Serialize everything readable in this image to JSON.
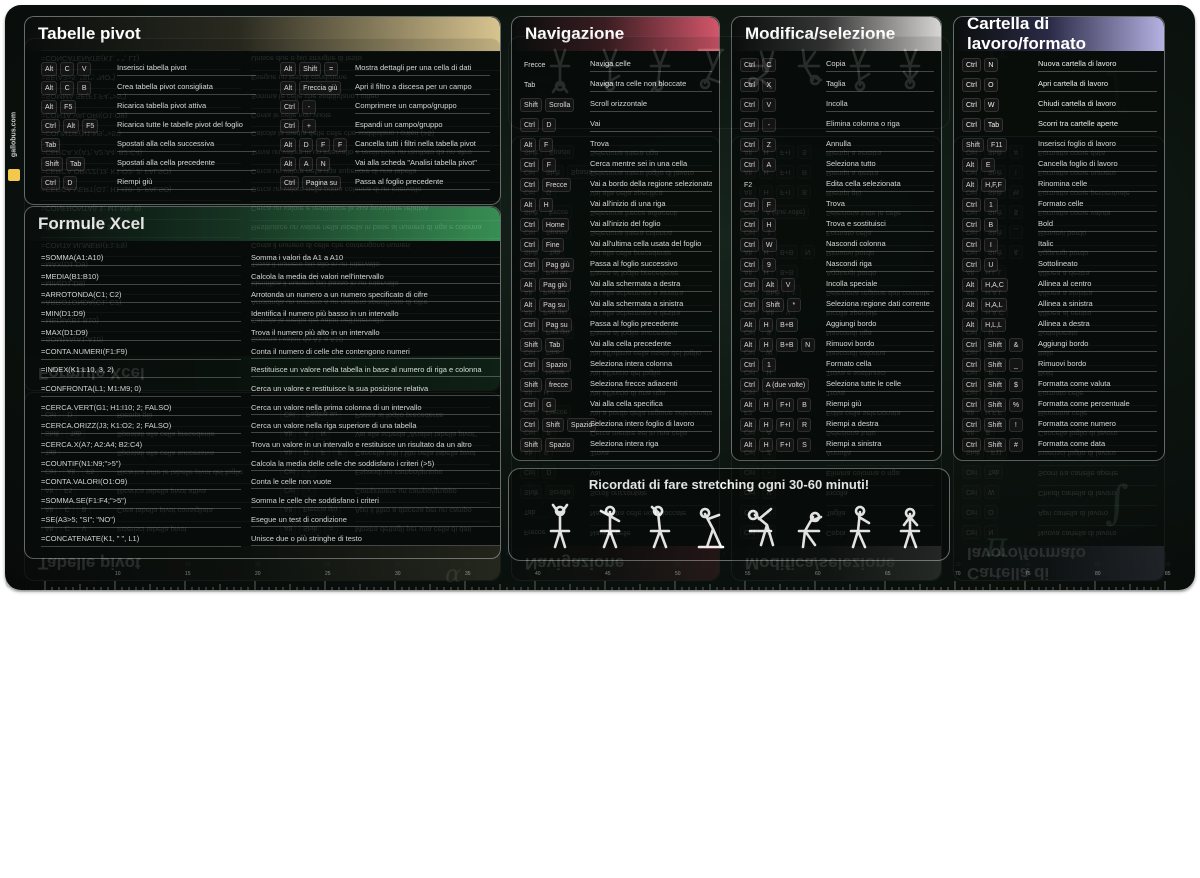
{
  "brand": {
    "name": "gallobus.com"
  },
  "stretch": {
    "title": "Ricordati di fare stretching ogni 30-60 minuti!"
  },
  "ruler": {
    "numbers": [
      "10",
      "15",
      "20",
      "25",
      "30",
      "35",
      "40",
      "45",
      "50",
      "55",
      "60",
      "65",
      "70",
      "75",
      "80",
      "85"
    ]
  },
  "pivot": {
    "title": "Tabelle pivot",
    "left": [
      {
        "keys": [
          "Alt",
          "C",
          "V"
        ],
        "desc": "Inserisci tabella pivot"
      },
      {
        "keys": [
          "Alt",
          "C",
          "B"
        ],
        "desc": "Crea tabella pivot consigliata"
      },
      {
        "keys": [
          "Alt",
          "F5"
        ],
        "desc": "Ricarica tabella pivot attiva"
      },
      {
        "keys": [
          "Ctrl",
          "Alt",
          "F5"
        ],
        "desc": "Ricarica tutte le tabelle pivot del foglio"
      },
      {
        "keys": [
          "Tab"
        ],
        "desc": "Spostati alla cella successiva"
      },
      {
        "keys": [
          "Shift",
          "Tab"
        ],
        "desc": "Spostati alla cella precedente"
      },
      {
        "keys": [
          "Ctrl",
          "D"
        ],
        "desc": "Riempi giù"
      }
    ],
    "right": [
      {
        "keys": [
          "Alt",
          "Shift",
          "="
        ],
        "desc": "Mostra dettagli per una cella di dati"
      },
      {
        "keys": [
          "Alt",
          "Freccia giù"
        ],
        "desc": "Apri il filtro a discesa per un campo"
      },
      {
        "keys": [
          "Ctrl",
          "-"
        ],
        "desc": "Comprimere un campo/gruppo"
      },
      {
        "keys": [
          "Ctrl",
          "+"
        ],
        "desc": "Espandi un campo/gruppo"
      },
      {
        "keys": [
          "Alt",
          "D",
          "F",
          "F"
        ],
        "desc": "Cancella tutti i filtri nella tabella pivot"
      },
      {
        "keys": [
          "Alt",
          "A",
          "N"
        ],
        "desc": "Vai alla scheda \"Analisi tabella pivot\""
      },
      {
        "keys": [
          "Ctrl",
          "Pagina su"
        ],
        "desc": "Passa al foglio precedente"
      }
    ]
  },
  "formulas": {
    "title": "Formule Xcel",
    "rows": [
      {
        "f": "=SOMMA(A1:A10)",
        "d": "Somma i valori da A1 a A10"
      },
      {
        "f": "=MEDIA(B1:B10)",
        "d": "Calcola la media dei valori nell'intervallo"
      },
      {
        "f": "=ARROTONDA(C1; C2)",
        "d": "Arrotonda un numero a un numero specificato di cifre"
      },
      {
        "f": "=MIN(D1:D9)",
        "d": "Identifica il numero più basso in un intervallo"
      },
      {
        "f": "=MAX(D1:D9)",
        "d": "Trova il numero più alto in un intervallo"
      },
      {
        "f": "=CONTA.NUMERI(F1:F9)",
        "d": "Conta il numero di celle che contengono numeri"
      },
      {
        "f": "=INDEX(K1:L10, 3, 2)",
        "d": "Restituisce un valore nella tabella in base al numero di riga e colonna"
      },
      {
        "f": "=CONFRONTA(L1; M1:M9; 0)",
        "d": "Cerca un valore e restituisce la sua posizione relativa"
      },
      {
        "f": "=CERCA.VERT(G1; H1:I10; 2; FALSO)",
        "d": "Cerca un valore nella prima colonna di un intervallo"
      },
      {
        "f": "=CERCA.ORIZZ(J3; K1:O2; 2; FALSO)",
        "d": "Cerca un valore nella riga superiore di una tabella"
      },
      {
        "f": "=CERCA.X(A7; A2:A4; B2:C4)",
        "d": "Trova un valore in un intervallo e restituisce un risultato da un altro"
      },
      {
        "f": "=COUNTIF(N1:N9;\">5\")",
        "d": "Calcola la media delle celle che soddisfano i criteri (>5)"
      },
      {
        "f": "=CONTA.VALORI(O1:O9)",
        "d": "Conta le celle non vuote"
      },
      {
        "f": "=SOMMA.SE(F1:F4;\">5\")",
        "d": "Somma le celle che soddisfano i criteri"
      },
      {
        "f": "=SE(A3>5; \"SI\"; \"NO\")",
        "d": "Esegue un test di condizione"
      },
      {
        "f": "=CONCATENATE(K1, \" \", L1)",
        "d": "Unisce due o più stringhe di testo"
      }
    ]
  },
  "navigation": {
    "title": "Navigazione",
    "rows": [
      {
        "keys": [
          "Frecce"
        ],
        "desc": "Naviga celle",
        "plain": true
      },
      {
        "keys": [
          "Tab"
        ],
        "desc": "Naviga tra celle non bloccate",
        "plain": true
      },
      {
        "keys": [
          "Shift",
          "Scrolla"
        ],
        "desc": "Scroll orizzontale"
      },
      {
        "keys": [
          "Ctrl",
          "D"
        ],
        "desc": "Vai"
      },
      {
        "keys": [
          "Alt",
          "F"
        ],
        "desc": "Trova"
      },
      {
        "keys": [
          "Ctrl",
          "F"
        ],
        "desc": "Cerca mentre sei in una cella"
      },
      {
        "keys": [
          "Ctrl",
          "Frecce"
        ],
        "desc": "Vai a bordo della regione selezionata"
      },
      {
        "keys": [
          "Alt",
          "H"
        ],
        "desc": "Vai all'inizio di una riga"
      },
      {
        "keys": [
          "Ctrl",
          "Home"
        ],
        "desc": "Vai all'inizio del foglio"
      },
      {
        "keys": [
          "Ctrl",
          "Fine"
        ],
        "desc": "Vai all'ultima cella usata del foglio"
      },
      {
        "keys": [
          "Ctrl",
          "Pag giù"
        ],
        "desc": "Passa al foglio successivo"
      },
      {
        "keys": [
          "Alt",
          "Pag giù"
        ],
        "desc": "Vai alla schermata a destra"
      },
      {
        "keys": [
          "Alt",
          "Pag su"
        ],
        "desc": "Vai alla schermata a sinistra"
      },
      {
        "keys": [
          "Ctrl",
          "Pag su"
        ],
        "desc": "Passa al foglio precedente"
      },
      {
        "keys": [
          "Shift",
          "Tab"
        ],
        "desc": "Vai alla cella precedente"
      },
      {
        "keys": [
          "Ctrl",
          "Spazio"
        ],
        "desc": "Seleziona intera colonna"
      },
      {
        "keys": [
          "Shift",
          "freccе"
        ],
        "desc": "Seleziona frecce adiacenti"
      },
      {
        "keys": [
          "Ctrl",
          "G"
        ],
        "desc": "Vai alla cella specifica"
      },
      {
        "keys": [
          "Ctrl",
          "Shift",
          "Spazio"
        ],
        "desc": "Seleziona intero foglio di lavoro"
      },
      {
        "keys": [
          "Shift",
          "Spazio"
        ],
        "desc": "Seleziona intera riga"
      }
    ]
  },
  "modify": {
    "title": "Modifica/selezione",
    "rows": [
      {
        "keys": [
          "Ctrl",
          "C"
        ],
        "desc": "Copia"
      },
      {
        "keys": [
          "Ctrl",
          "X"
        ],
        "desc": "Taglia"
      },
      {
        "keys": [
          "Ctrl",
          "V"
        ],
        "desc": "Incolla"
      },
      {
        "keys": [
          "Ctrl",
          "-"
        ],
        "desc": "Elimina colonna o riga"
      },
      {
        "keys": [
          "Ctrl",
          "Z"
        ],
        "desc": "Annulla"
      },
      {
        "keys": [
          "Ctrl",
          "A"
        ],
        "desc": "Seleziona tutto"
      },
      {
        "keys": [
          "F2"
        ],
        "desc": "Edita cella selezionata",
        "plain": true
      },
      {
        "keys": [
          "Ctrl",
          "F"
        ],
        "desc": "Trova"
      },
      {
        "keys": [
          "Ctrl",
          "H"
        ],
        "desc": "Trova e sostituisci"
      },
      {
        "keys": [
          "Ctrl",
          "W"
        ],
        "desc": "Nascondi colonna"
      },
      {
        "keys": [
          "Ctrl",
          "9"
        ],
        "desc": "Nascondi riga"
      },
      {
        "keys": [
          "Ctrl",
          "Alt",
          "V"
        ],
        "desc": "Incolla speciale"
      },
      {
        "keys": [
          "Ctrl",
          "Shift",
          "*"
        ],
        "desc": "Seleziona regione dati corrente"
      },
      {
        "keys": [
          "Alt",
          "H",
          "B+B"
        ],
        "desc": "Aggiungi bordo"
      },
      {
        "keys": [
          "Alt",
          "H",
          "B+B",
          "N"
        ],
        "desc": "Rimuovi bordo"
      },
      {
        "keys": [
          "Ctrl",
          "1"
        ],
        "desc": "Formato cella"
      },
      {
        "keys": [
          "Ctrl",
          "A (due volte)"
        ],
        "desc": "Seleziona tutte le celle"
      },
      {
        "keys": [
          "Alt",
          "H",
          "F+I",
          "B"
        ],
        "desc": "Riempi giù"
      },
      {
        "keys": [
          "Alt",
          "H",
          "F+I",
          "R"
        ],
        "desc": "Riempi a destra"
      },
      {
        "keys": [
          "Alt",
          "H",
          "F+I",
          "S"
        ],
        "desc": "Riempi a sinistra"
      }
    ]
  },
  "workbook": {
    "title": "Cartella di lavoro/formato",
    "rows": [
      {
        "keys": [
          "Ctrl",
          "N"
        ],
        "desc": "Nuova cartella di lavoro"
      },
      {
        "keys": [
          "Ctrl",
          "O"
        ],
        "desc": "Apri cartella di lavoro"
      },
      {
        "keys": [
          "Ctrl",
          "W"
        ],
        "desc": "Chiudi cartella di lavoro"
      },
      {
        "keys": [
          "Ctrl",
          "Tab"
        ],
        "desc": "Scorri tra cartelle aperte"
      },
      {
        "keys": [
          "Shift",
          "F11"
        ],
        "desc": "Inserisci foglio di lavoro"
      },
      {
        "keys": [
          "Alt",
          "E"
        ],
        "desc": "Cancella foglio di lavoro"
      },
      {
        "keys": [
          "Alt",
          "H,F,F"
        ],
        "desc": "Rinomina celle"
      },
      {
        "keys": [
          "Ctrl",
          "1"
        ],
        "desc": "Formato celle"
      },
      {
        "keys": [
          "Ctrl",
          "B"
        ],
        "desc": "Bold"
      },
      {
        "keys": [
          "Ctrl",
          "I"
        ],
        "desc": "Italic"
      },
      {
        "keys": [
          "Ctrl",
          "U"
        ],
        "desc": "Sottolineato"
      },
      {
        "keys": [
          "Alt",
          "H,A,C"
        ],
        "desc": "Allinea al centro"
      },
      {
        "keys": [
          "Alt",
          "H,A,L"
        ],
        "desc": "Allinea a sinistra"
      },
      {
        "keys": [
          "Alt",
          "H,L,L"
        ],
        "desc": "Allinea a destra"
      },
      {
        "keys": [
          "Ctrl",
          "Shift",
          "&"
        ],
        "desc": "Aggiungi bordo"
      },
      {
        "keys": [
          "Ctrl",
          "Shift",
          "_"
        ],
        "desc": "Rimuovi bordo"
      },
      {
        "keys": [
          "Ctrl",
          "Shift",
          "$"
        ],
        "desc": "Formatta come valuta"
      },
      {
        "keys": [
          "Ctrl",
          "Shift",
          "%"
        ],
        "desc": "Formatta come percentuale"
      },
      {
        "keys": [
          "Ctrl",
          "Shift",
          "!"
        ],
        "desc": "Formatta come numero"
      },
      {
        "keys": [
          "Ctrl",
          "Shift",
          "#"
        ],
        "desc": "Formatta come data"
      }
    ]
  }
}
